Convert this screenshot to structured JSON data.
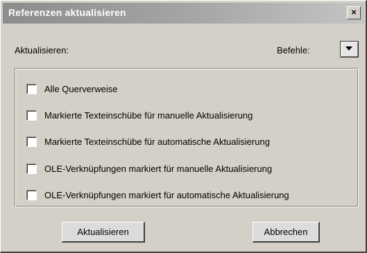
{
  "window": {
    "title": "Referenzen aktualisieren",
    "close_glyph": "×"
  },
  "header": {
    "aktualisieren_label": "Aktualisieren:",
    "befehle_label": "Befehle:",
    "menu_icon": "triangle-down-icon"
  },
  "options": [
    {
      "label": "Alle Querverweise",
      "checked": false
    },
    {
      "label": "Markierte Texteinschübe für manuelle Aktualisierung",
      "checked": false
    },
    {
      "label": "Markierte Texteinschübe für automatische Aktualisierung",
      "checked": false
    },
    {
      "label": "OLE-Verknüpfungen markiert für manuelle Aktualisierung",
      "checked": false
    },
    {
      "label": "OLE-Verknüpfungen markiert für automatische Aktualisierung",
      "checked": false
    }
  ],
  "buttons": {
    "update_label": "Aktualisieren",
    "cancel_label": "Abbrechen"
  }
}
